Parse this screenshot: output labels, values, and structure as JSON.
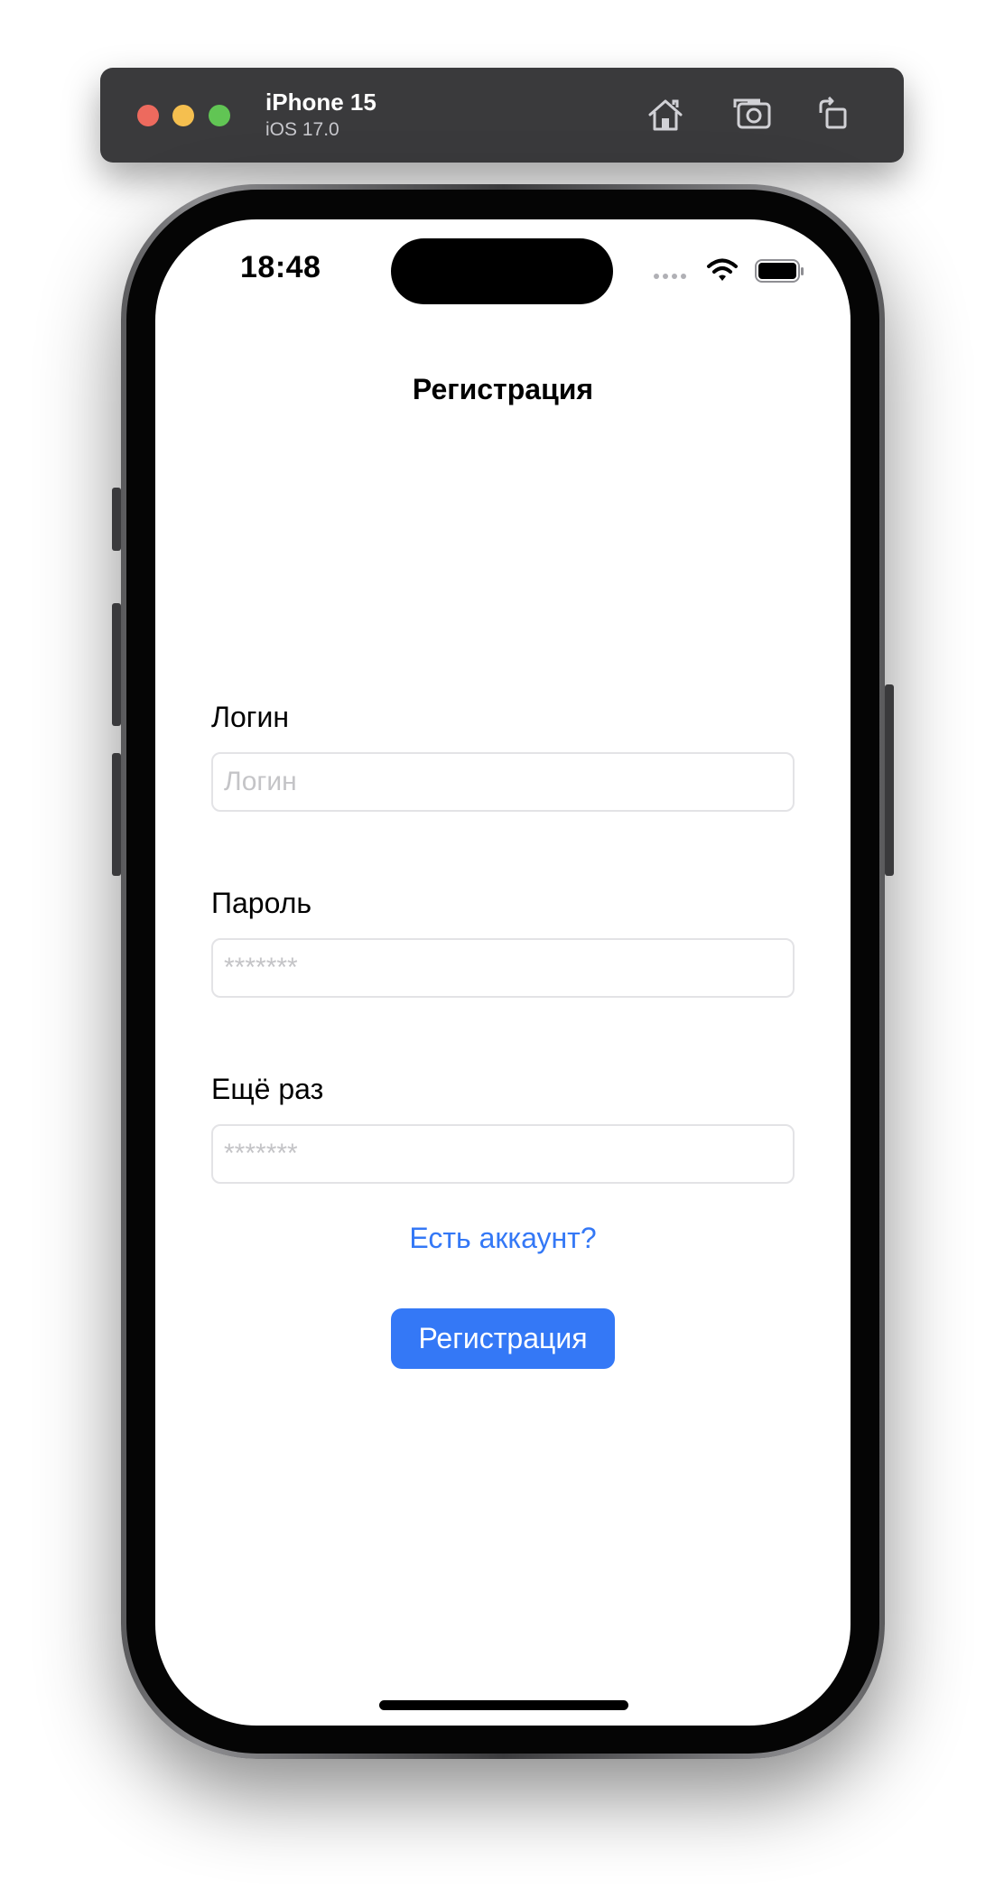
{
  "simulator": {
    "device_name": "iPhone 15",
    "os_version": "iOS 17.0",
    "buttons": {
      "home": "home-icon",
      "screenshot": "camera-icon",
      "rotate": "rotate-icon"
    },
    "traffic_colors": {
      "close": "#ed6a5e",
      "minimize": "#f5bf4f",
      "zoom": "#61c554"
    }
  },
  "status_bar": {
    "time": "18:48",
    "icons": [
      "cellular-icon",
      "wifi-icon",
      "battery-icon"
    ]
  },
  "screen": {
    "nav_title": "Регистрация",
    "fields": [
      {
        "label": "Логин",
        "placeholder": "Логин",
        "value": ""
      },
      {
        "label": "Пароль",
        "placeholder": "*******",
        "value": ""
      },
      {
        "label": "Ещё раз",
        "placeholder": "*******",
        "value": ""
      }
    ],
    "have_account_link": "Есть аккаунт?",
    "register_button": "Регистрация"
  },
  "colors": {
    "accent": "#3478f6",
    "placeholder": "#c4c4c7",
    "field_border": "#e3e3e6"
  }
}
